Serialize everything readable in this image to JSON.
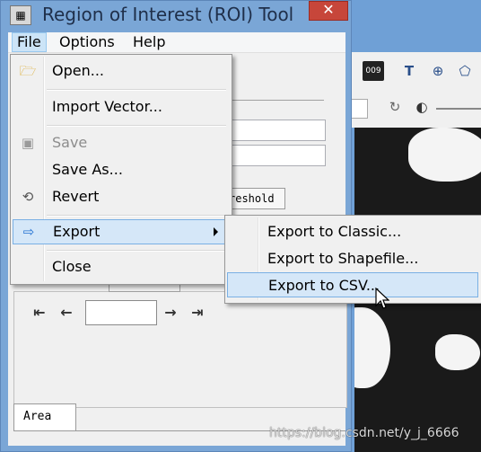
{
  "window": {
    "title": "Region of Interest (ROI) Tool",
    "close_glyph": "✕"
  },
  "menubar": {
    "items": [
      {
        "label": "File"
      },
      {
        "label": "Options"
      },
      {
        "label": "Help"
      }
    ]
  },
  "file_menu": {
    "items": [
      {
        "label": "Open...",
        "icon": "folder-open-icon",
        "enabled": true
      },
      {
        "label": "Import Vector...",
        "icon": "",
        "enabled": true
      },
      {
        "label": "Save",
        "icon": "floppy-disk-icon",
        "enabled": false
      },
      {
        "label": "Save As...",
        "icon": "",
        "enabled": true
      },
      {
        "label": "Revert",
        "icon": "revert-arrows-icon",
        "enabled": true
      },
      {
        "label": "Export",
        "icon": "export-arrow-icon",
        "enabled": true,
        "submenu": true
      },
      {
        "label": "Close",
        "icon": "",
        "enabled": true
      }
    ]
  },
  "export_submenu": {
    "items": [
      {
        "label": "Export to Classic..."
      },
      {
        "label": "Export to Shapefile..."
      },
      {
        "label": "Export to CSV..."
      }
    ]
  },
  "tabs": {
    "partial_tab": "reshold",
    "area_tab": "Area"
  },
  "toolbar": {
    "zoom_badge": "009"
  },
  "watermark": "https://blog.csdn.net/y_j_6666",
  "colors": {
    "highlight": "#d5e7f8",
    "highlight_border": "#7ab0e4",
    "close_red": "#c7463a"
  }
}
